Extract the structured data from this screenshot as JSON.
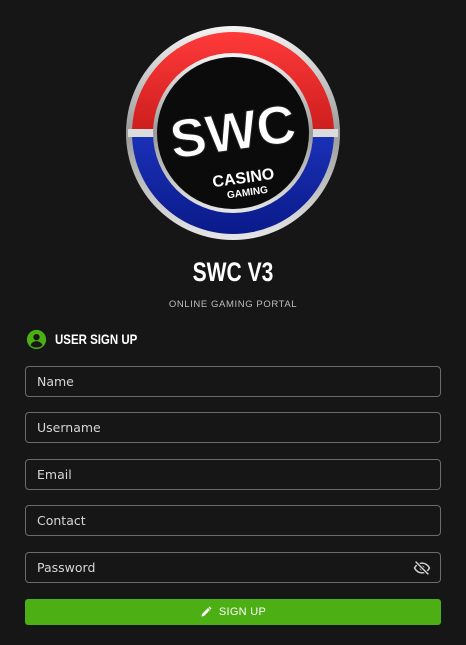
{
  "logo": {
    "brand": "SWC",
    "line1": "CASINO",
    "line2": "GAMING"
  },
  "header": {
    "title": "SWC V3",
    "subtitle": "ONLINE GAMING PORTAL"
  },
  "section": {
    "title": "USER SIGN UP",
    "icon": "user-circle-icon"
  },
  "form": {
    "name_placeholder": "Name",
    "username_placeholder": "Username",
    "email_placeholder": "Email",
    "contact_placeholder": "Contact",
    "password_placeholder": "Password",
    "password_toggle_icon": "eye-slash-icon",
    "submit_label": "SIGN UP",
    "submit_icon": "pencil-icon"
  },
  "colors": {
    "background": "#161616",
    "accent_green": "#4caf14",
    "logo_red": "#d3141b",
    "logo_blue": "#1f3fcf"
  }
}
